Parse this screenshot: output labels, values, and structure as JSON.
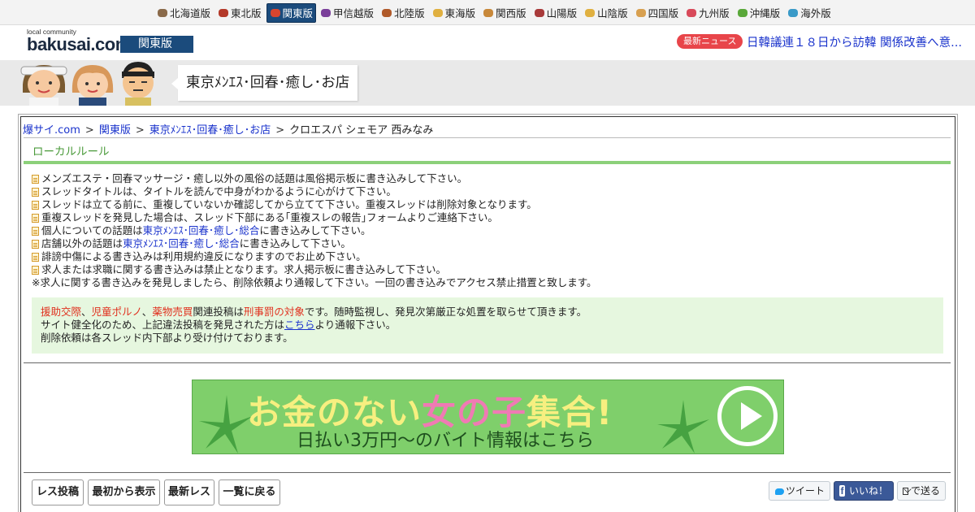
{
  "region_nav": {
    "items": [
      {
        "label": "北海道版",
        "icon": "cow-icon",
        "color": "#8a6a4a",
        "active": false
      },
      {
        "label": "東北版",
        "icon": "namahage-icon",
        "color": "#b43a2a",
        "active": false
      },
      {
        "label": "関東版",
        "icon": "tokyo-tower-icon",
        "color": "#d8452e",
        "active": true
      },
      {
        "label": "甲信越版",
        "icon": "grape-icon",
        "color": "#7a3f9a",
        "active": false
      },
      {
        "label": "北陸版",
        "icon": "gate-icon",
        "color": "#b05a2a",
        "active": false
      },
      {
        "label": "東海版",
        "icon": "shachihoko-icon",
        "color": "#e0b040",
        "active": false
      },
      {
        "label": "関西版",
        "icon": "takoyaki-icon",
        "color": "#c8883a",
        "active": false
      },
      {
        "label": "山陽版",
        "icon": "castle-icon",
        "color": "#a83a3a",
        "active": false
      },
      {
        "label": "山陰版",
        "icon": "crab-icon",
        "color": "#e0b040",
        "active": false
      },
      {
        "label": "四国版",
        "icon": "udon-icon",
        "color": "#d8a050",
        "active": false
      },
      {
        "label": "九州版",
        "icon": "mentaiko-icon",
        "color": "#d84a5a",
        "active": false
      },
      {
        "label": "沖縄版",
        "icon": "shisa-icon",
        "color": "#5aa83a",
        "active": false
      },
      {
        "label": "海外版",
        "icon": "globe-icon",
        "color": "#3a9ac8",
        "active": false
      }
    ]
  },
  "header": {
    "logo_small": "local community",
    "logo": "bakusai.com",
    "edition": "関東版",
    "news_badge": "最新ニュース",
    "news_headline": "日韓議連１８日から訪韓 関係改善へ意..."
  },
  "banner": {
    "board_title": "東京ﾒﾝｴｽ･回春･癒し･お店"
  },
  "breadcrumb": {
    "home": "爆サイ.com",
    "edition": "関東版",
    "board": "東京ﾒﾝｴｽ･回春･癒し･お店",
    "current": "クロエスパ シェモア 西みなみ",
    "sep": ">"
  },
  "local_rules": {
    "title": "ローカルルール",
    "line1": "メンズエステ・回春マッサージ・癒し以外の風俗の話題は風俗掲示板に書き込みして下さい。",
    "line2": "スレッドタイトルは、タイトルを読んで中身がわかるように心がけて下さい。",
    "line3": "スレッドは立てる前に、重複していないか確認してから立てて下さい。重複スレッドは削除対象となります。",
    "line4": "重複スレッドを発見した場合は、スレッド下部にある｢重複スレの報告｣フォームよりご連絡下さい。",
    "line5_pre": "個人についての話題は",
    "line5_link": "東京ﾒﾝｴｽ･回春･癒し･総合",
    "line5_post": "に書き込みして下さい。",
    "line6_pre": "店舗以外の話題は",
    "line6_link": "東京ﾒﾝｴｽ･回春･癒し･総合",
    "line6_post": "に書き込みして下さい。",
    "line7": "誹謗中傷による書き込みは利用規約違反になりますのでお止め下さい。",
    "line8": "求人または求職に関する書き込みは禁止となります。求人掲示板に書き込みして下さい。",
    "line9": "※求人に関する書き込みを発見しましたら、削除依頼より通報して下さい。一回の書き込みでアクセス禁止措置と致します。"
  },
  "notice": {
    "t1": "援助交際",
    "c1": "、",
    "t2": "児童ポルノ",
    "c2": "、",
    "t3": "薬物売買",
    "mid": "関連投稿は",
    "t4": "刑事罰の対象",
    "end": "です。随時監視し、発見次第厳正な処置を取らせて頂きます。",
    "line2_pre": "サイト健全化のため、上記違法投稿を発見された方は",
    "line2_link": "こちら",
    "line2_post": "より通報下さい。",
    "line3": "削除依頼は各スレッド内下部より受け付けております。"
  },
  "ad": {
    "title_a": "お金のない",
    "title_b": "女の子",
    "title_c": "集合!",
    "subtitle": "日払い3万円〜のバイト情報はこちら"
  },
  "actions": {
    "post": "レス投稿",
    "from_start": "最初から表示",
    "latest": "最新レス",
    "back_list": "一覧に戻る"
  },
  "share": {
    "tweet": "ツイート",
    "like": "いいね！",
    "mail": "で送る"
  }
}
